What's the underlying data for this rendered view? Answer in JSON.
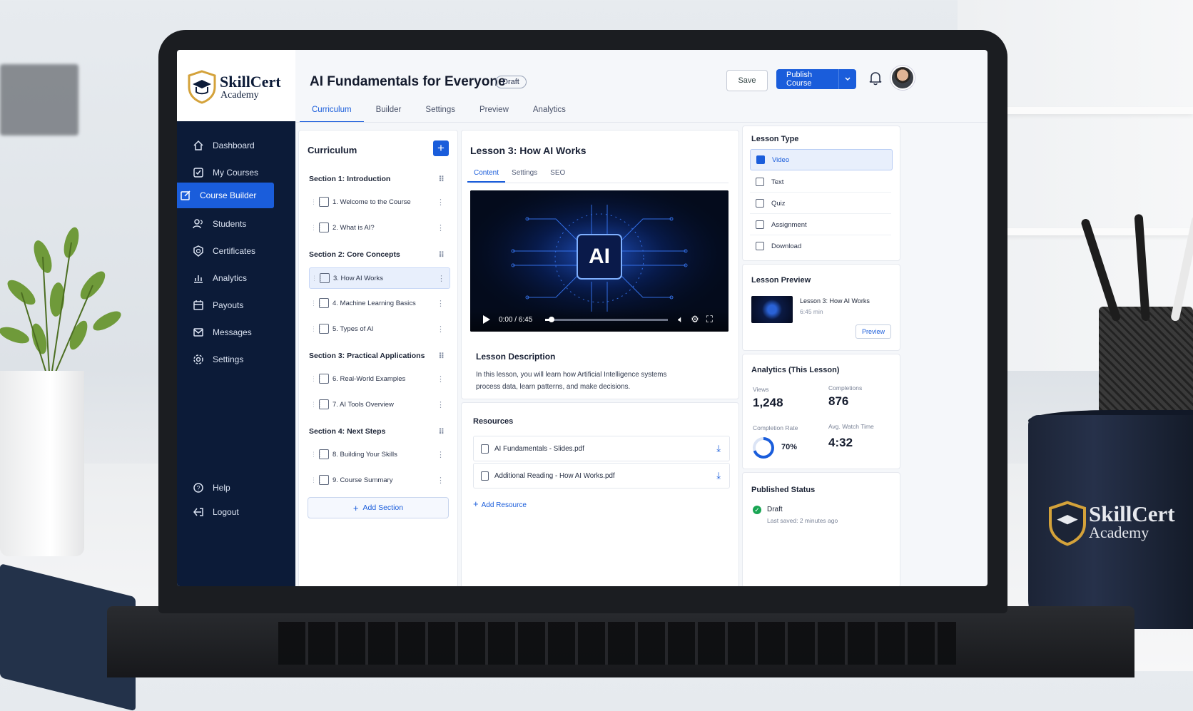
{
  "brand": {
    "name": "SkillCert",
    "sub": "Academy"
  },
  "sidebar": {
    "items": [
      {
        "label": "Dashboard",
        "icon": "home-icon"
      },
      {
        "label": "My Courses",
        "icon": "check-square-icon"
      },
      {
        "label": "Course Builder",
        "icon": "edit-icon",
        "active": true
      },
      {
        "label": "Students",
        "icon": "users-icon"
      },
      {
        "label": "Certificates",
        "icon": "badge-icon"
      },
      {
        "label": "Analytics",
        "icon": "chart-icon"
      },
      {
        "label": "Payouts",
        "icon": "calendar-icon"
      },
      {
        "label": "Messages",
        "icon": "mail-icon"
      },
      {
        "label": "Settings",
        "icon": "gear-icon"
      }
    ],
    "footer": [
      {
        "label": "Help",
        "icon": "help-icon"
      },
      {
        "label": "Logout",
        "icon": "logout-icon"
      }
    ]
  },
  "header": {
    "title": "AI Fundamentals for Everyone",
    "badge": "Draft",
    "save_label": "Save",
    "publish_label": "Publish Course",
    "tabs": [
      "Curriculum",
      "Builder",
      "Settings",
      "Preview",
      "Analytics"
    ],
    "active_tab": "Curriculum"
  },
  "curriculum": {
    "title": "Curriculum",
    "add_icon": "+",
    "sections": [
      {
        "title": "Section 1: Introduction",
        "lessons": [
          "1. Welcome to the Course",
          "2. What is AI?"
        ]
      },
      {
        "title": "Section 2: Core Concepts",
        "lessons": [
          "3. How AI Works",
          "4. Machine Learning Basics",
          "5. Types of AI"
        ]
      },
      {
        "title": "Section 3: Practical Applications",
        "lessons": [
          "6. Real-World Examples",
          "7. AI Tools Overview"
        ]
      },
      {
        "title": "Section 4: Next Steps",
        "lessons": [
          "8. Building Your Skills",
          "9. Course Summary"
        ]
      }
    ],
    "active_lesson": "3. How AI Works",
    "add_section_label": "Add Section"
  },
  "lesson": {
    "title": "Lesson 3: How AI Works",
    "tabs": [
      "Content",
      "Settings",
      "SEO"
    ],
    "active_tab": "Content",
    "video": {
      "chip_text": "AI",
      "time": "0:00 / 6:45",
      "progress": 0.05
    },
    "description_title": "Lesson Description",
    "description": "In this lesson, you will learn how Artificial Intelligence systems process data, learn patterns, and make decisions."
  },
  "resources": {
    "title": "Resources",
    "files": [
      "AI Fundamentals - Slides.pdf",
      "Additional Reading - How AI Works.pdf"
    ],
    "add_label": "Add Resource"
  },
  "lesson_type": {
    "title": "Lesson Type",
    "options": [
      "Video",
      "Text",
      "Quiz",
      "Assignment",
      "Download"
    ],
    "selected": "Video"
  },
  "lesson_preview": {
    "title": "Lesson Preview",
    "item_title": "Lesson 3: How AI Works",
    "length": "6:45 min",
    "button": "Preview"
  },
  "analytics": {
    "title": "Analytics (This Lesson)",
    "views_label": "Views",
    "views": "1,248",
    "completions_label": "Completions",
    "completions": "876",
    "completion_rate_label": "Completion Rate",
    "completion_rate": "70%",
    "completion_rate_value": 0.7,
    "watch_time_label": "Avg. Watch Time",
    "watch_time": "4:32"
  },
  "publish": {
    "title": "Published Status",
    "status": "Draft",
    "saved": "Last saved: 2 minutes ago"
  },
  "mug": {
    "name": "SkillCert",
    "sub": "Academy"
  },
  "colors": {
    "accent": "#1a5ddb",
    "sidebar": "#0c1b38",
    "success": "#19a553"
  }
}
